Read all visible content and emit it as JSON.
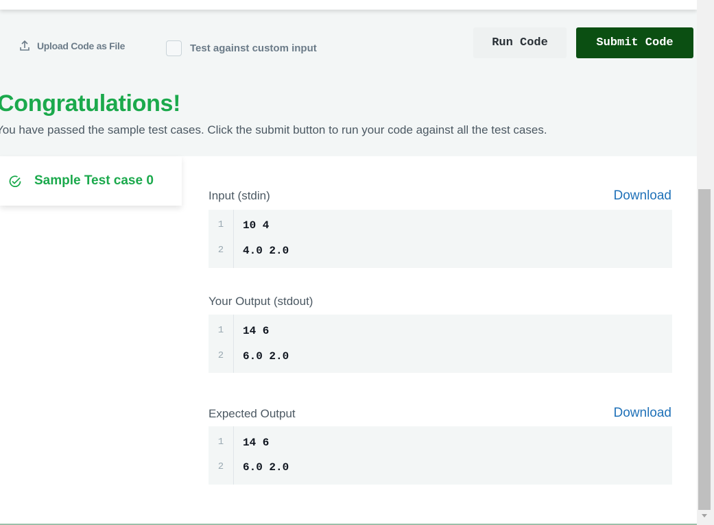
{
  "toolbar": {
    "upload_label": "Upload Code as File",
    "custom_input_label": "Test against custom input",
    "run_label": "Run Code",
    "submit_label": "Submit Code"
  },
  "result": {
    "title": "Congratulations!",
    "message": "You have passed the sample test cases. Click the submit button to run your code against all the test cases."
  },
  "testcase": {
    "tab_label": "Sample Test case 0",
    "input": {
      "label": "Input (stdin)",
      "download": "Download",
      "lines": [
        {
          "n": "1",
          "text": "10 4"
        },
        {
          "n": "2",
          "text": "4.0 2.0"
        }
      ]
    },
    "output": {
      "label": "Your Output (stdout)",
      "lines": [
        {
          "n": "1",
          "text": "14 6"
        },
        {
          "n": "2",
          "text": "6.0 2.0"
        }
      ]
    },
    "expected": {
      "label": "Expected Output",
      "download": "Download",
      "lines": [
        {
          "n": "1",
          "text": "14 6"
        },
        {
          "n": "2",
          "text": "6.0 2.0"
        }
      ]
    }
  },
  "icons": {
    "upload": "upload-icon",
    "tab_status": "check-circle-icon",
    "scroll_down": "scroll-down-arrow-icon"
  },
  "colors": {
    "success_green": "#1ba94c",
    "submit_bg": "#0b4f12",
    "link_blue": "#1f71b8"
  }
}
